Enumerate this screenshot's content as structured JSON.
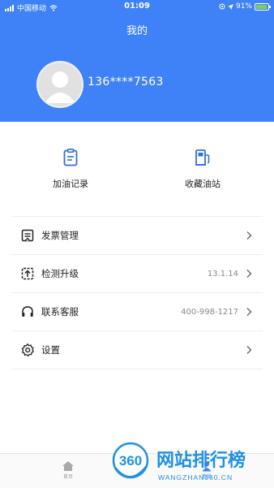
{
  "status_bar": {
    "carrier": "中国移动",
    "time": "01:09",
    "battery": "91%",
    "battery_level": 0.91
  },
  "header": {
    "title": "我的",
    "phone": "136****7563"
  },
  "quick_actions": [
    {
      "label": "加油记录",
      "icon": "clipboard-icon"
    },
    {
      "label": "收藏油站",
      "icon": "fuel-pump-icon"
    }
  ],
  "menu": [
    {
      "label": "发票管理",
      "icon": "invoice-icon",
      "value": ""
    },
    {
      "label": "检测升级",
      "icon": "upgrade-icon",
      "value": "13.1.14"
    },
    {
      "label": "联系客服",
      "icon": "headset-icon",
      "value": "400-998-1217"
    },
    {
      "label": "设置",
      "icon": "settings-icon",
      "value": ""
    }
  ],
  "tabbar": {
    "home_label": "首页",
    "mine_label": "我的"
  },
  "watermark": {
    "logo": "360",
    "name": "网站排行榜",
    "domain": "WANGZHAN360.CN"
  },
  "colors": {
    "brand_blue": "#3f82f7",
    "icon_blue": "#2f6fe0"
  }
}
